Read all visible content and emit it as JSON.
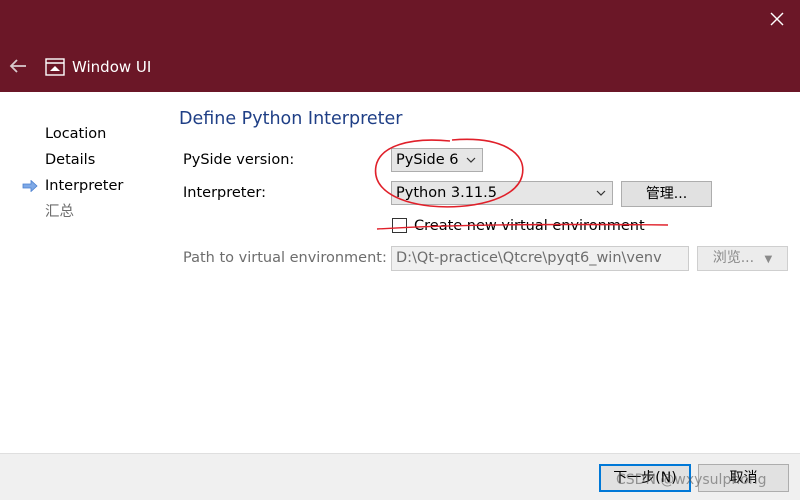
{
  "titlebar": {
    "title": "Window UI",
    "background_color": "#6b1727",
    "icons": {
      "back": "back-arrow-icon",
      "app": "window-app-icon",
      "close": "close-icon"
    }
  },
  "nav": {
    "items": [
      {
        "label": "Location",
        "state": "done"
      },
      {
        "label": "Details",
        "state": "done"
      },
      {
        "label": "Interpreter",
        "state": "current"
      },
      {
        "label": "汇总",
        "state": "pending"
      }
    ],
    "current_indicator_icon": "current-step-arrow-icon"
  },
  "page": {
    "title": "Define Python Interpreter",
    "title_color": "#1f3f86",
    "pyside": {
      "label": "PySide version:",
      "selected": "PySide 6"
    },
    "interpreter": {
      "label": "Interpreter:",
      "selected": "Python 3.11.5",
      "manage_button": "管理..."
    },
    "venv_checkbox": {
      "label": "Create new virtual environment",
      "checked": false
    },
    "venv_path": {
      "label": "Path to virtual environment:",
      "value": "D:\\Qt-practice\\Qtcre\\pyqt6_win\\venv",
      "browse_button": "浏览..."
    }
  },
  "footer": {
    "next_button": "下一步(N)",
    "cancel_button": "取消"
  },
  "annotation_color": "#e0202a",
  "watermark": "CSDN @wxysulphong"
}
